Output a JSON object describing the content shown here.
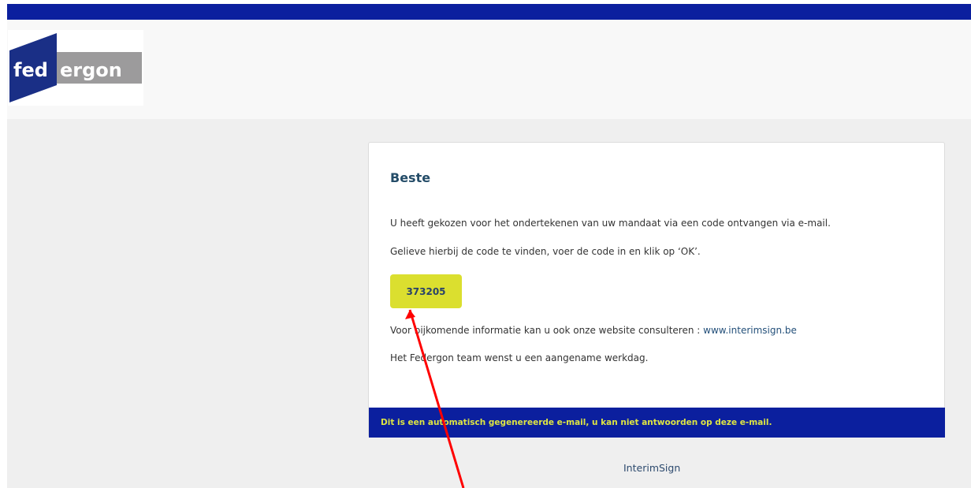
{
  "logo": {
    "text_left": "fed",
    "text_right": "ergon",
    "colors": {
      "navy": "#1a2f86",
      "gray": "#9c9b9c",
      "white": "#ffffff"
    }
  },
  "email": {
    "greeting": "Beste",
    "paragraph1": "U heeft gekozen voor het ondertekenen van uw mandaat via een code ontvangen via e-mail.",
    "paragraph2": "Gelieve hierbij de code te vinden, voer de code in en klik op ‘OK’.",
    "code": "373205",
    "paragraph3_prefix": "Voor bijkomende informatie kan u ook onze website consulteren : ",
    "website_link": "www.interimsign.be",
    "paragraph4": "Het Federgon team wenst u een aangename werkdag.",
    "footer_notice": "Dit is een automatisch gegenereerde e-mail, u kan niet antwoorden op deze e-mail."
  },
  "brand_footer": "InterimSign",
  "colors": {
    "header_bar": "#0b1f9e",
    "code_badge": "#dbdf2f",
    "footer_text": "#dfe642",
    "annotation_arrow": "#ff0000"
  }
}
